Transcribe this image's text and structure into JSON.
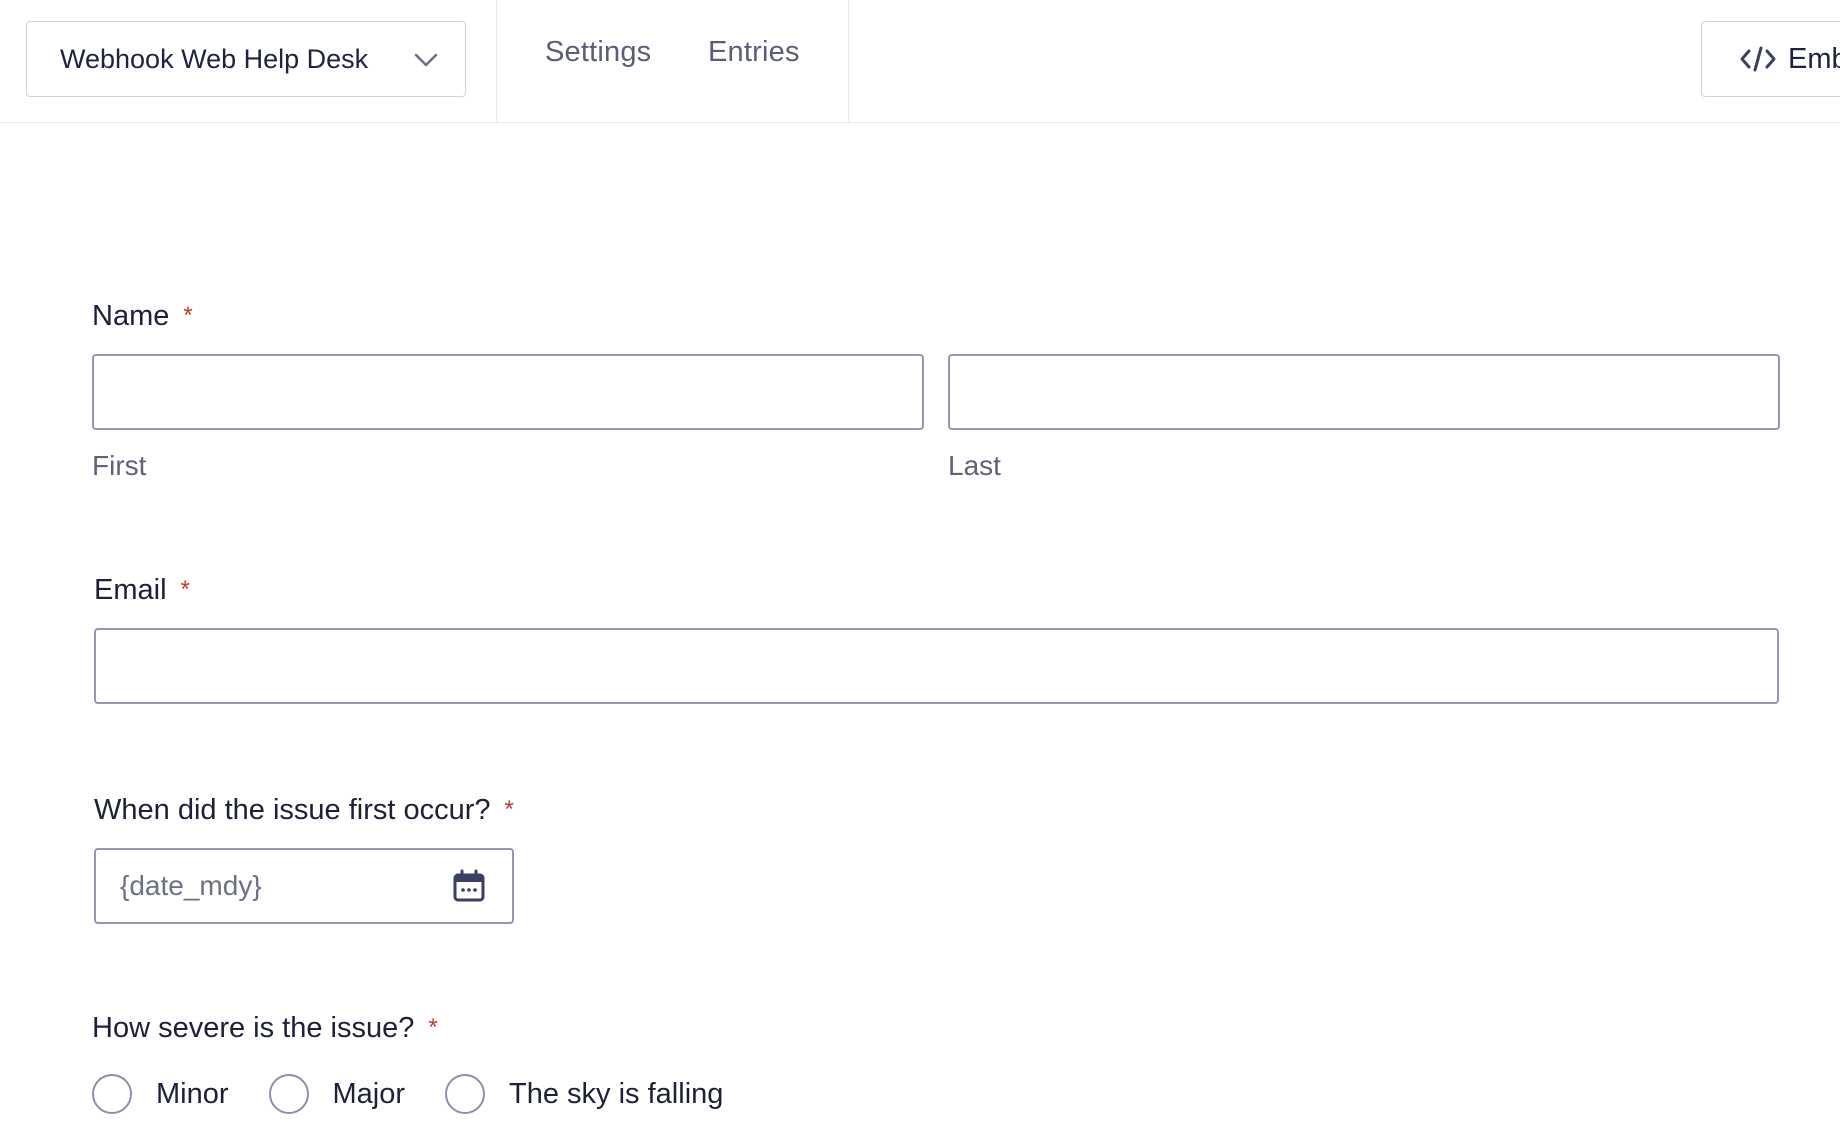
{
  "header": {
    "form_selector": {
      "value": "Webhook Web Help Desk"
    },
    "nav": [
      {
        "label": "Settings"
      },
      {
        "label": "Entries"
      }
    ],
    "embed_button": {
      "label": "Embed"
    }
  },
  "form": {
    "name_field": {
      "label": "Name",
      "required_mark": "*",
      "first": {
        "value": "",
        "sub_label": "First"
      },
      "last": {
        "value": "",
        "sub_label": "Last"
      }
    },
    "email_field": {
      "label": "Email",
      "required_mark": "*",
      "value": ""
    },
    "date_field": {
      "label": "When did the issue first occur?",
      "required_mark": "*",
      "value": "",
      "placeholder": "{date_mdy}"
    },
    "severity_field": {
      "label": "How severe is the issue?",
      "required_mark": "*",
      "options": [
        {
          "label": "Minor",
          "selected": false
        },
        {
          "label": "Major",
          "selected": false
        },
        {
          "label": "The sky is falling",
          "selected": false
        }
      ]
    }
  },
  "icons": {
    "form_selector": "chevron-down-icon",
    "embed": "code-icon",
    "date": "calendar-icon"
  },
  "colors": {
    "required": "#c0392b",
    "input_border": "#9497b5",
    "nav_text": "#5b5e7a",
    "divider": "#e5e6ee"
  }
}
